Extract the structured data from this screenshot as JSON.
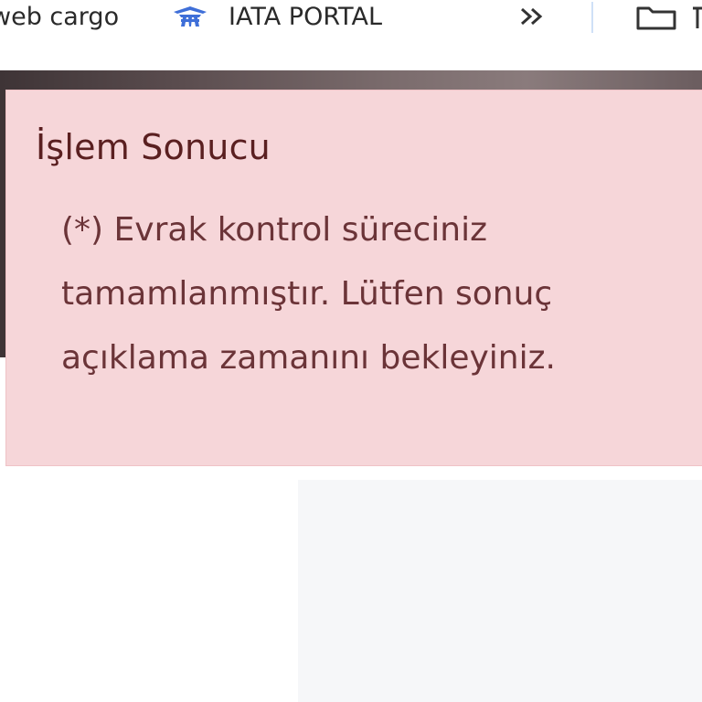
{
  "bookmarks": {
    "items": [
      {
        "label": "web cargo",
        "icon": "none"
      },
      {
        "label": "IATA PORTAL",
        "icon": "iata-logo-icon"
      }
    ],
    "overflow_glyph": "»",
    "folder_icon": "folder-icon"
  },
  "alert": {
    "title": "İşlem Sonucu",
    "message_lines": [
      "(*) Evrak kontrol süreciniz",
      "tamamlanmıştır. Lütfen sonuç",
      "açıklama zamanını bekleyiniz."
    ],
    "colors": {
      "background": "#f6d6d9",
      "title": "#5a1f20",
      "text": "#6b3438"
    }
  },
  "colors": {
    "iata_blue": "#3f6fd8"
  }
}
